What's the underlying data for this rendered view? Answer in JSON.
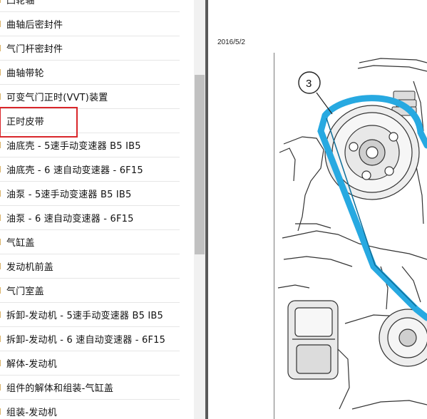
{
  "toc": {
    "items": [
      {
        "label": "凸轮轴"
      },
      {
        "label": "曲轴后密封件"
      },
      {
        "label": "气门杆密封件"
      },
      {
        "label": "曲轴带轮"
      },
      {
        "label": "可变气门正时(VVT)装置"
      },
      {
        "label": "正时皮带",
        "selected": true
      },
      {
        "label": "油底壳 - 5速手动变速器 B5 IB5"
      },
      {
        "label": "油底壳 - 6 速自动变速器 - 6F15"
      },
      {
        "label": "油泵 - 5速手动变速器 B5 IB5"
      },
      {
        "label": "油泵 - 6 速自动变速器 - 6F15"
      },
      {
        "label": "气缸盖"
      },
      {
        "label": "发动机前盖"
      },
      {
        "label": "气门室盖"
      },
      {
        "label": "拆卸-发动机 - 5速手动变速器 B5 IB5"
      },
      {
        "label": "拆卸-发动机 - 6 速自动变速器 - 6F15"
      },
      {
        "label": "解体-发动机"
      },
      {
        "label": "组件的解体和组装-气缸盖"
      },
      {
        "label": "组装-发动机"
      }
    ]
  },
  "document": {
    "date": "2016/5/2",
    "figure": {
      "callout": "3",
      "belt_color": "#27a9e1"
    }
  }
}
